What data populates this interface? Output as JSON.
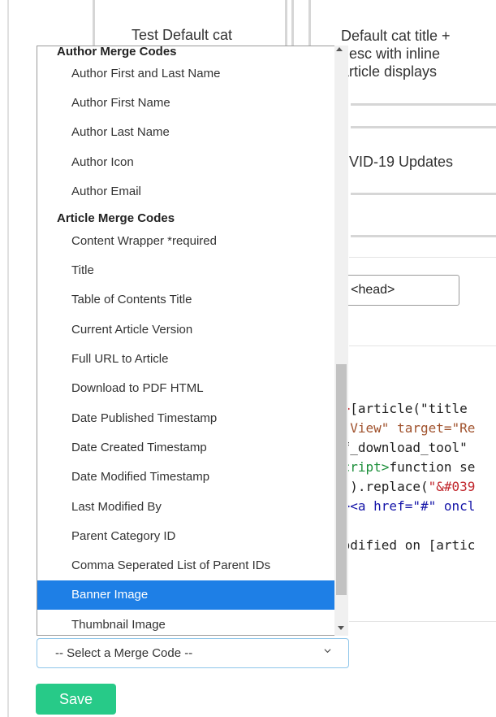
{
  "table": {
    "cells": [
      "Test Default cat",
      "Default cat title +\ndesc with inline\narticle displays",
      ")VID-19 Updates"
    ]
  },
  "bg_button_label": "stom <head>",
  "code_lines": [
    {
      "segments": [
        {
          "text": "\">",
          "color": "#c1272d"
        },
        {
          "text": "[article(\"title",
          "color": "#1f1f1f"
        }
      ]
    },
    {
      "segments": [
        {
          "text": "r View\" target=\"Re",
          "color": "#a0522d"
        }
      ]
    },
    {
      "segments": [
        {
          "text": "df_download_tool\"",
          "color": "#1f1f1f"
        }
      ]
    },
    {
      "segments": [
        {
          "text": "script>",
          "color": "#1c8f3a"
        },
        {
          "text": "function se",
          "color": "#1f1f1f"
        }
      ]
    },
    {
      "segments": [
        {
          "text": "'\"",
          "color": "#c1272d"
        },
        {
          "text": ").replace(",
          "color": "#1f1f1f"
        },
        {
          "text": "\"&#039",
          "color": "#c1272d"
        }
      ]
    },
    {
      "segments": [
        {
          "text": "t><a href=\"#\" oncl",
          "color": "#1515a8"
        }
      ]
    },
    {
      "segments": [
        {
          "text": "",
          "color": "#1f1f1f"
        }
      ]
    },
    {
      "segments": [
        {
          "text": "Modified on [artic",
          "color": "#1f1f1f"
        }
      ]
    }
  ],
  "dropdown": {
    "groups": [
      {
        "label": "Author Merge Codes",
        "options": [
          "Author First and Last Name",
          "Author First Name",
          "Author Last Name",
          "Author Icon",
          "Author Email"
        ]
      },
      {
        "label": "Article Merge Codes",
        "options": [
          "Content Wrapper *required",
          "Title",
          "Table of Contents Title",
          "Current Article Version",
          "Full URL to Article",
          "Download to PDF HTML",
          "Date Published Timestamp",
          "Date Created Timestamp",
          "Date Modified Timestamp",
          "Last Modified By",
          "Parent Category ID",
          "Comma Seperated List of Parent IDs",
          "Banner Image",
          "Thumbnail Image"
        ]
      }
    ],
    "selected_option": "Banner Image",
    "highlight_color": "#1e7fe6"
  },
  "select": {
    "value": "-- Select a Merge Code --"
  },
  "save_label": "Save",
  "colors": {
    "save": "#27ca88",
    "select_border": "#8dc5ea"
  }
}
